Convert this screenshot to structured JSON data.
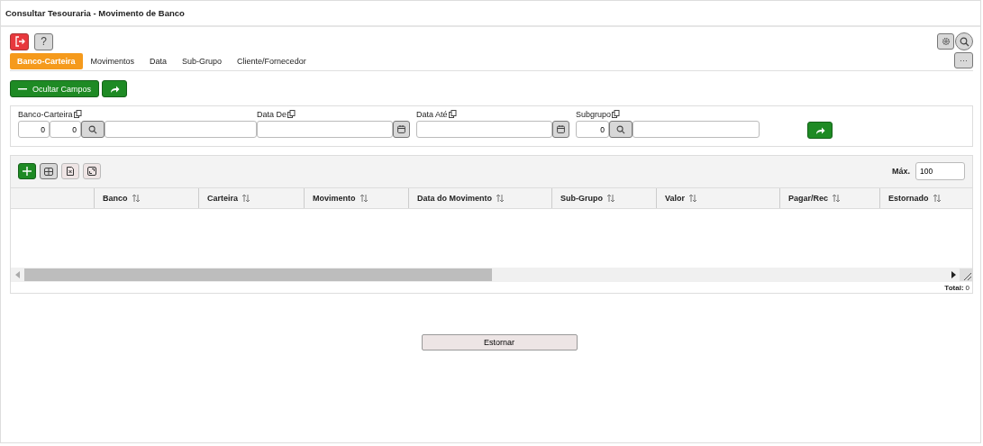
{
  "window": {
    "title": "Consultar Tesouraria - Movimento de Banco"
  },
  "help_button": "?",
  "more_button": "···",
  "tabs": [
    {
      "label": "Banco-Carteira",
      "selected": true
    },
    {
      "label": "Movimentos",
      "selected": false
    },
    {
      "label": "Data",
      "selected": false
    },
    {
      "label": "Sub-Grupo",
      "selected": false
    },
    {
      "label": "Cliente/Fornecedor",
      "selected": false
    }
  ],
  "hide_fields_button": "Ocultar Campos",
  "filters": [
    {
      "kind": "code-lookup",
      "label": "Banco-Carteira",
      "values": [
        "0",
        "0"
      ]
    },
    {
      "kind": "date",
      "label": "Data De"
    },
    {
      "kind": "date",
      "label": "Data Até"
    },
    {
      "kind": "lookup",
      "label": "Subgrupo",
      "values": [
        "0"
      ]
    }
  ],
  "grid": {
    "max_label": "Máx.",
    "max_value": "100",
    "columns": [
      "",
      "Banco",
      "Carteira",
      "Movimento",
      "Data do Movimento",
      "Sub-Grupo",
      "Valor",
      "Pagar/Rec",
      "Estornado"
    ],
    "total_label": "Total:",
    "total_value": "0"
  },
  "footer_button": "Estornar"
}
